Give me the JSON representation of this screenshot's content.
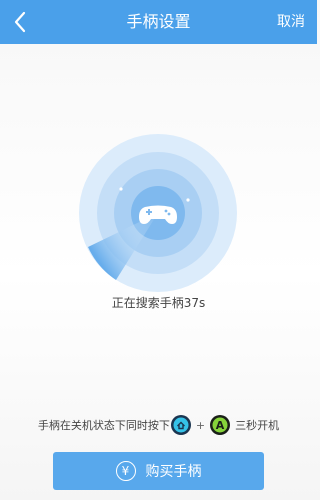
{
  "header": {
    "title": "手柄设置",
    "cancel_label": "取消"
  },
  "status": {
    "searching_text": "正在搜索手柄37s"
  },
  "hint": {
    "text_before": "手柄在关机状态下同时按下",
    "plus": "+",
    "text_after": "三秒开机",
    "a_button_label": "A"
  },
  "buy_button": {
    "label": "购买手柄",
    "currency_symbol": "¥"
  },
  "colors": {
    "header": "#4aa0ea",
    "button": "#58a8ec",
    "radar": "#6aaee8"
  }
}
